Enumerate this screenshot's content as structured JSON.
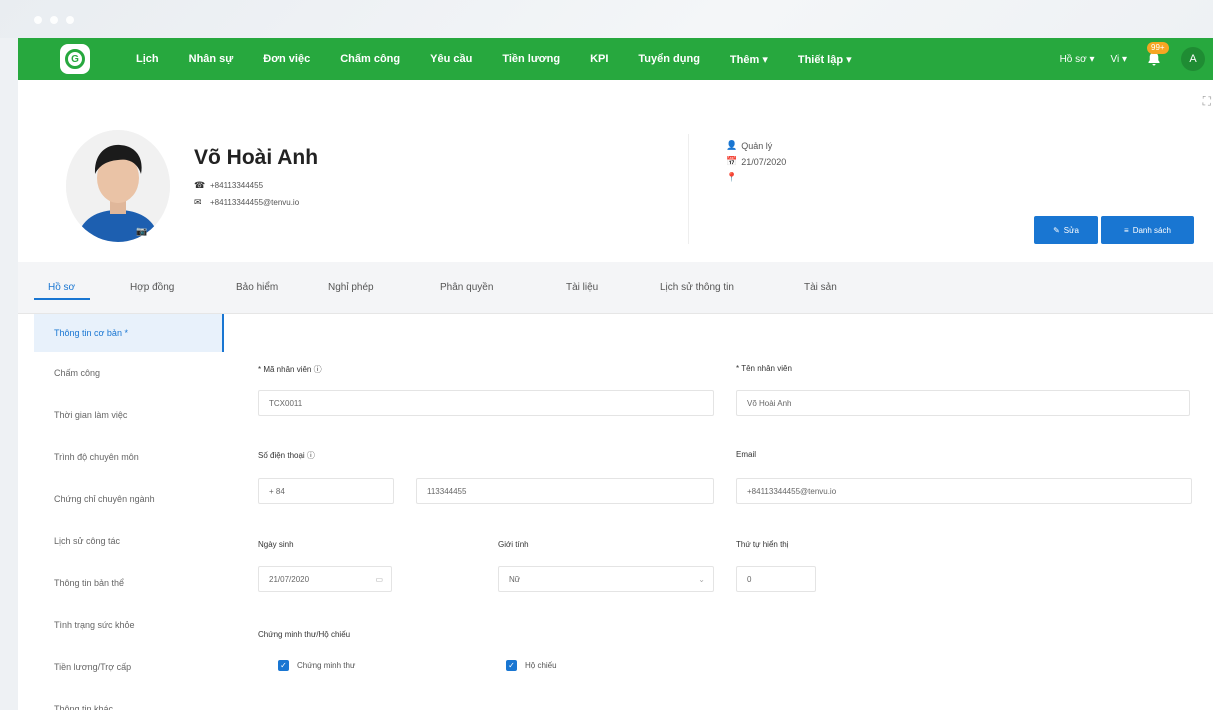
{
  "nav": {
    "logo": "G",
    "items": [
      "Lịch",
      "Nhân sự",
      "Đơn việc",
      "Chấm công",
      "Yêu cầu",
      "Tiền lương",
      "KPI",
      "Tuyển dụng",
      "Thêm ▾",
      "Thiết lập ▾"
    ],
    "right_items": [
      "Hồ sơ ▾",
      "Vi ▾"
    ],
    "notification_count": "99+",
    "avatar_initial": "A"
  },
  "profile": {
    "name": "Võ Hoài Anh",
    "phone": "+84113344455",
    "email": "+84113344455@tenvu.io",
    "role": "Quản lý",
    "date": "21/07/2020",
    "location": ""
  },
  "buttons": {
    "save": "Sửa",
    "list": "Danh sách"
  },
  "tabs": [
    "Hồ sơ",
    "Hợp đồng",
    "Bảo hiểm",
    "Nghỉ phép",
    "Phân quyền",
    "Tài liệu",
    "Lịch sử thông tin",
    "Tài sản"
  ],
  "sidebar": [
    "Thông tin cơ bản *",
    "Chấm công",
    "Thời gian làm việc",
    "Trình độ chuyên môn",
    "Chứng chỉ chuyên ngành",
    "Lịch sử công tác",
    "Thông tin bản thể",
    "Tình trạng sức khỏe",
    "Tiền lương/Trợ cấp",
    "Thông tin khác"
  ],
  "form": {
    "employee_code_label": "* Mã nhân viên ⓘ",
    "employee_code": "TCX0011",
    "employee_name_label": "* Tên nhân viên",
    "employee_name": "Võ Hoài Anh",
    "phone_label": "Số điện thoại ⓘ",
    "phone_prefix": "+ 84",
    "phone_number": "113344455",
    "email_label": "Email",
    "email": "+84113344455@tenvu.io",
    "dob_label": "Ngày sinh",
    "dob": "21/07/2020",
    "gender_label": "Giới tính",
    "gender": "Nữ",
    "order_label": "Thứ tự hiển thị",
    "order": "0",
    "id_label": "Chứng minh thư/Hộ chiếu",
    "id_option_1": "Chứng minh thư",
    "id_option_2": "Hộ chiếu"
  }
}
